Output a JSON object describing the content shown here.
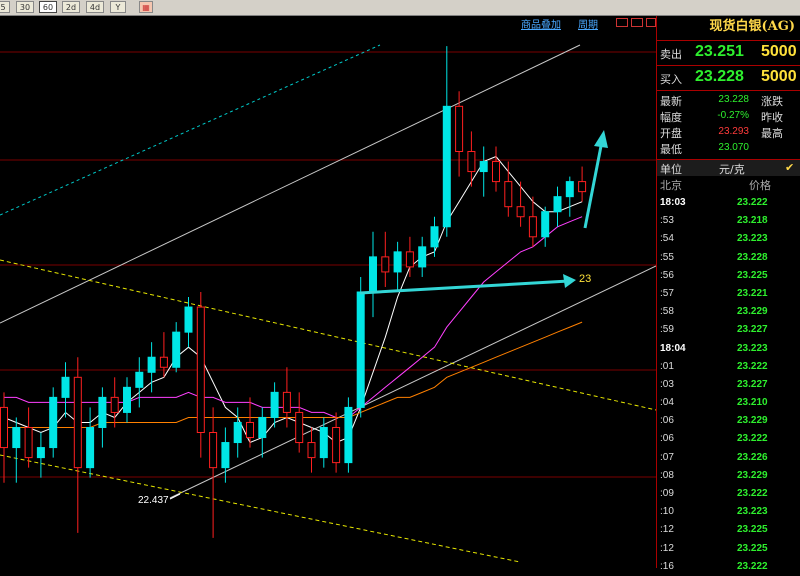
{
  "toolbar": {
    "buttons": [
      {
        "label": "5",
        "active": false
      },
      {
        "label": "30",
        "active": false
      },
      {
        "label": "60",
        "active": true
      },
      {
        "label": "2d",
        "active": false
      },
      {
        "label": "4d",
        "active": false
      },
      {
        "label": "Y",
        "active": false
      },
      {
        "label": "",
        "active": false
      }
    ]
  },
  "chart_menu": {
    "overlay_label": "商品叠加",
    "period_label": "周期"
  },
  "chart": {
    "low_label": "22.437",
    "target_label": "23",
    "colors": {
      "up": "#00e6e6",
      "down": "#ff2020",
      "ma5": "#ffffff",
      "ma10": "#ffff00",
      "ma20": "#ff40ff",
      "ma40": "#00c000",
      "ma60": "#ff8000",
      "ma120": "#8080ff",
      "channel": "#c8c8c8",
      "dashed_yellow": "#e6e600",
      "dashed_cyan": "#00c8c8",
      "arrow": "#33d6d6"
    }
  },
  "chart_data": {
    "type": "candlestick",
    "title": "",
    "low_marker": 22.437,
    "target": 23,
    "candles": [
      {
        "o": 22.7,
        "h": 22.73,
        "l": 22.55,
        "c": 22.62
      },
      {
        "o": 22.62,
        "h": 22.68,
        "l": 22.55,
        "c": 22.66
      },
      {
        "o": 22.66,
        "h": 22.7,
        "l": 22.58,
        "c": 22.6
      },
      {
        "o": 22.6,
        "h": 22.65,
        "l": 22.56,
        "c": 22.62
      },
      {
        "o": 22.62,
        "h": 22.74,
        "l": 22.6,
        "c": 22.72
      },
      {
        "o": 22.72,
        "h": 22.79,
        "l": 22.68,
        "c": 22.76
      },
      {
        "o": 22.76,
        "h": 22.8,
        "l": 22.45,
        "c": 22.58
      },
      {
        "o": 22.58,
        "h": 22.7,
        "l": 22.56,
        "c": 22.66
      },
      {
        "o": 22.66,
        "h": 22.74,
        "l": 22.62,
        "c": 22.72
      },
      {
        "o": 22.72,
        "h": 22.76,
        "l": 22.66,
        "c": 22.69
      },
      {
        "o": 22.69,
        "h": 22.76,
        "l": 22.67,
        "c": 22.74
      },
      {
        "o": 22.74,
        "h": 22.8,
        "l": 22.7,
        "c": 22.77
      },
      {
        "o": 22.77,
        "h": 22.83,
        "l": 22.73,
        "c": 22.8
      },
      {
        "o": 22.8,
        "h": 22.85,
        "l": 22.76,
        "c": 22.78
      },
      {
        "o": 22.78,
        "h": 22.87,
        "l": 22.77,
        "c": 22.85
      },
      {
        "o": 22.85,
        "h": 22.92,
        "l": 22.82,
        "c": 22.9
      },
      {
        "o": 22.9,
        "h": 22.93,
        "l": 22.6,
        "c": 22.65
      },
      {
        "o": 22.65,
        "h": 22.7,
        "l": 22.44,
        "c": 22.58
      },
      {
        "o": 22.58,
        "h": 22.66,
        "l": 22.55,
        "c": 22.63
      },
      {
        "o": 22.63,
        "h": 22.7,
        "l": 22.6,
        "c": 22.67
      },
      {
        "o": 22.67,
        "h": 22.72,
        "l": 22.62,
        "c": 22.64
      },
      {
        "o": 22.64,
        "h": 22.7,
        "l": 22.6,
        "c": 22.68
      },
      {
        "o": 22.68,
        "h": 22.75,
        "l": 22.66,
        "c": 22.73
      },
      {
        "o": 22.73,
        "h": 22.78,
        "l": 22.66,
        "c": 22.69
      },
      {
        "o": 22.69,
        "h": 22.73,
        "l": 22.61,
        "c": 22.63
      },
      {
        "o": 22.63,
        "h": 22.66,
        "l": 22.57,
        "c": 22.6
      },
      {
        "o": 22.6,
        "h": 22.68,
        "l": 22.58,
        "c": 22.66
      },
      {
        "o": 22.66,
        "h": 22.69,
        "l": 22.57,
        "c": 22.59
      },
      {
        "o": 22.59,
        "h": 22.72,
        "l": 22.57,
        "c": 22.7
      },
      {
        "o": 22.7,
        "h": 22.96,
        "l": 22.68,
        "c": 22.93
      },
      {
        "o": 22.93,
        "h": 23.05,
        "l": 22.88,
        "c": 23.0
      },
      {
        "o": 23.0,
        "h": 23.05,
        "l": 22.94,
        "c": 22.97
      },
      {
        "o": 22.97,
        "h": 23.03,
        "l": 22.93,
        "c": 23.01
      },
      {
        "o": 23.01,
        "h": 23.04,
        "l": 22.96,
        "c": 22.98
      },
      {
        "o": 22.98,
        "h": 23.04,
        "l": 22.96,
        "c": 23.02
      },
      {
        "o": 23.02,
        "h": 23.08,
        "l": 23.0,
        "c": 23.06
      },
      {
        "o": 23.06,
        "h": 23.42,
        "l": 23.04,
        "c": 23.3
      },
      {
        "o": 23.3,
        "h": 23.33,
        "l": 23.16,
        "c": 23.21
      },
      {
        "o": 23.21,
        "h": 23.25,
        "l": 23.14,
        "c": 23.17
      },
      {
        "o": 23.17,
        "h": 23.22,
        "l": 23.12,
        "c": 23.19
      },
      {
        "o": 23.19,
        "h": 23.22,
        "l": 23.13,
        "c": 23.15
      },
      {
        "o": 23.15,
        "h": 23.19,
        "l": 23.08,
        "c": 23.1
      },
      {
        "o": 23.1,
        "h": 23.15,
        "l": 23.06,
        "c": 23.08
      },
      {
        "o": 23.08,
        "h": 23.12,
        "l": 23.02,
        "c": 23.04
      },
      {
        "o": 23.04,
        "h": 23.1,
        "l": 23.02,
        "c": 23.09
      },
      {
        "o": 23.09,
        "h": 23.14,
        "l": 23.06,
        "c": 23.12
      },
      {
        "o": 23.12,
        "h": 23.16,
        "l": 23.08,
        "c": 23.15
      },
      {
        "o": 23.15,
        "h": 23.18,
        "l": 23.11,
        "c": 23.13
      }
    ],
    "moving_averages": [
      {
        "name": "MA5",
        "values": [
          22.68,
          22.67,
          22.66,
          22.65,
          22.66,
          22.69,
          22.67,
          22.67,
          22.69,
          22.68,
          22.71,
          22.73,
          22.75,
          22.76,
          22.8,
          22.82,
          22.8,
          22.75,
          22.7,
          22.68,
          22.63,
          22.64,
          22.67,
          22.68,
          22.67,
          22.66,
          22.65,
          22.63,
          22.64,
          22.7,
          22.77,
          22.84,
          22.92,
          22.98,
          23.0,
          23.01,
          23.07,
          23.11,
          23.15,
          23.19,
          23.2,
          23.17,
          23.14,
          23.11,
          23.09,
          23.09,
          23.1,
          23.11
        ]
      },
      {
        "name": "MA20",
        "values": [
          22.72,
          22.72,
          22.71,
          22.71,
          22.71,
          22.71,
          22.71,
          22.71,
          22.71,
          22.71,
          22.71,
          22.72,
          22.72,
          22.72,
          22.72,
          22.73,
          22.72,
          22.72,
          22.71,
          22.71,
          22.71,
          22.7,
          22.7,
          22.7,
          22.7,
          22.69,
          22.69,
          22.68,
          22.68,
          22.7,
          22.72,
          22.74,
          22.76,
          22.78,
          22.8,
          22.82,
          22.86,
          22.89,
          22.92,
          22.95,
          22.97,
          22.99,
          23.01,
          23.02,
          23.04,
          23.06,
          23.07,
          23.08
        ]
      },
      {
        "name": "MA60",
        "values": [
          22.66,
          22.66,
          22.66,
          22.66,
          22.66,
          22.66,
          22.66,
          22.66,
          22.67,
          22.67,
          22.67,
          22.67,
          22.67,
          22.67,
          22.67,
          22.68,
          22.68,
          22.68,
          22.68,
          22.68,
          22.68,
          22.68,
          22.68,
          22.68,
          22.68,
          22.68,
          22.68,
          22.68,
          22.68,
          22.69,
          22.7,
          22.71,
          22.72,
          22.72,
          22.73,
          22.74,
          22.76,
          22.77,
          22.78,
          22.79,
          22.8,
          22.81,
          22.82,
          22.83,
          22.84,
          22.85,
          22.86,
          22.87
        ]
      }
    ]
  },
  "panel": {
    "title": "现货白银(AG)",
    "sell": {
      "label": "卖出",
      "price": "23.251",
      "volume": "5000"
    },
    "buy": {
      "label": "买入",
      "price": "23.228",
      "volume": "5000"
    },
    "stats": [
      {
        "label": "最新",
        "value": "23.228",
        "color": "green",
        "label2": "涨跌"
      },
      {
        "label": "幅度",
        "value": "-0.27%",
        "color": "green",
        "label2": "昨收"
      },
      {
        "label": "开盘",
        "value": "23.293",
        "color": "red",
        "label2": "最高"
      },
      {
        "label": "最低",
        "value": "23.070",
        "color": "green",
        "label2": ""
      }
    ],
    "unit": {
      "label": "单位",
      "value": "元/克",
      "check": "✔"
    },
    "tick_header": {
      "time": "北京",
      "price": "价格"
    },
    "ticks": [
      {
        "time": "18:03",
        "price": "23.222"
      },
      {
        "time": ":53",
        "price": "23.218"
      },
      {
        "time": ":54",
        "price": "23.223"
      },
      {
        "time": ":55",
        "price": "23.228"
      },
      {
        "time": ":56",
        "price": "23.225"
      },
      {
        "time": ":57",
        "price": "23.221"
      },
      {
        "time": ":58",
        "price": "23.229"
      },
      {
        "time": ":59",
        "price": "23.227"
      },
      {
        "time": "18:04",
        "price": "23.223"
      },
      {
        "time": ":01",
        "price": "23.222"
      },
      {
        "time": ":03",
        "price": "23.227"
      },
      {
        "time": ":04",
        "price": "23.210"
      },
      {
        "time": ":06",
        "price": "23.229"
      },
      {
        "time": ":06",
        "price": "23.222"
      },
      {
        "time": ":07",
        "price": "23.226"
      },
      {
        "time": ":08",
        "price": "23.229"
      },
      {
        "time": ":09",
        "price": "23.222"
      },
      {
        "time": ":10",
        "price": "23.223"
      },
      {
        "time": ":12",
        "price": "23.225"
      },
      {
        "time": ":12",
        "price": "23.225"
      },
      {
        "time": ":16",
        "price": "23.222"
      }
    ]
  }
}
